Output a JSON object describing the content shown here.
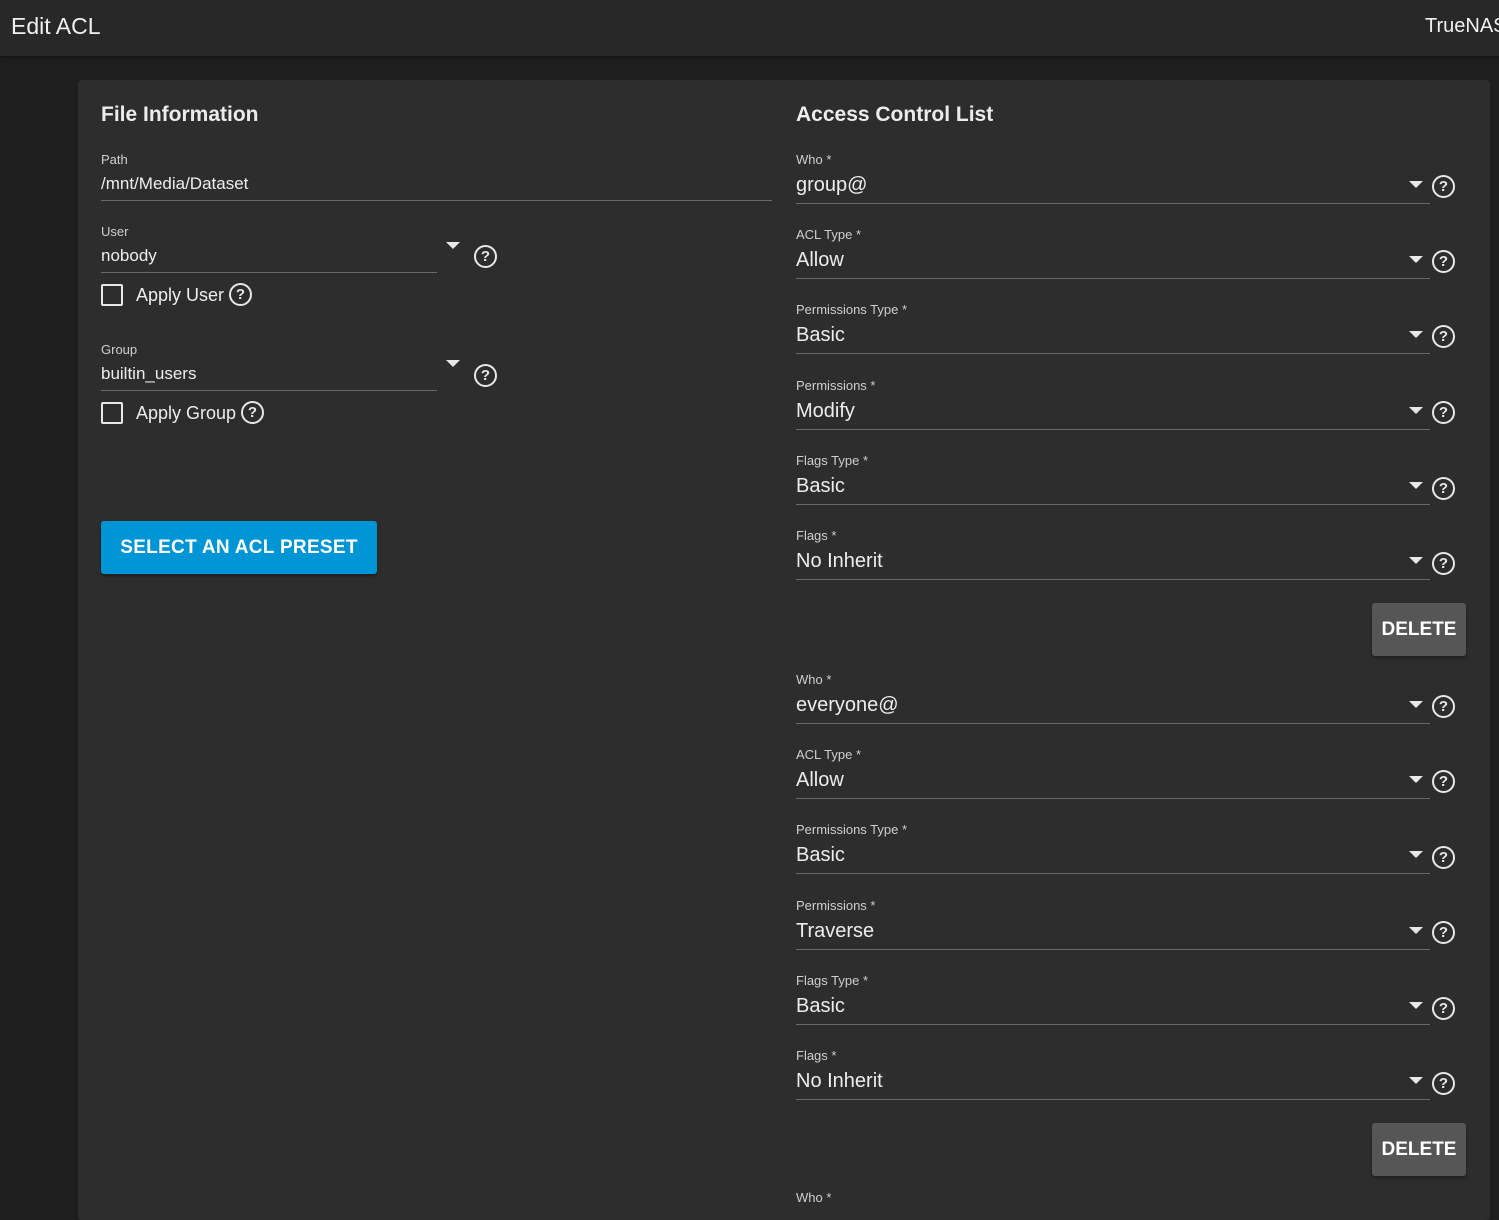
{
  "header": {
    "title": "Edit ACL",
    "brand": "TrueNAS"
  },
  "file_info": {
    "title": "File Information",
    "path": {
      "label": "Path",
      "value": "/mnt/Media/Dataset"
    },
    "user": {
      "label": "User",
      "value": "nobody"
    },
    "apply_user": {
      "label": "Apply User",
      "checked": false
    },
    "group": {
      "label": "Group",
      "value": "builtin_users"
    },
    "apply_group": {
      "label": "Apply Group",
      "checked": false
    },
    "preset_button": "SELECT AN ACL PRESET"
  },
  "acl": {
    "title": "Access Control List",
    "help_glyph": "?",
    "delete_label": "DELETE",
    "entries": [
      {
        "who": {
          "label": "Who *",
          "value": "group@"
        },
        "acl_type": {
          "label": "ACL Type *",
          "value": "Allow"
        },
        "permissions_type": {
          "label": "Permissions Type *",
          "value": "Basic"
        },
        "permissions": {
          "label": "Permissions *",
          "value": "Modify"
        },
        "flags_type": {
          "label": "Flags Type *",
          "value": "Basic"
        },
        "flags": {
          "label": "Flags *",
          "value": "No Inherit"
        }
      },
      {
        "who": {
          "label": "Who *",
          "value": "everyone@"
        },
        "acl_type": {
          "label": "ACL Type *",
          "value": "Allow"
        },
        "permissions_type": {
          "label": "Permissions Type *",
          "value": "Basic"
        },
        "permissions": {
          "label": "Permissions *",
          "value": "Traverse"
        },
        "flags_type": {
          "label": "Flags Type *",
          "value": "Basic"
        },
        "flags": {
          "label": "Flags *",
          "value": "No Inherit"
        }
      },
      {
        "who": {
          "label": "Who *"
        }
      }
    ]
  }
}
